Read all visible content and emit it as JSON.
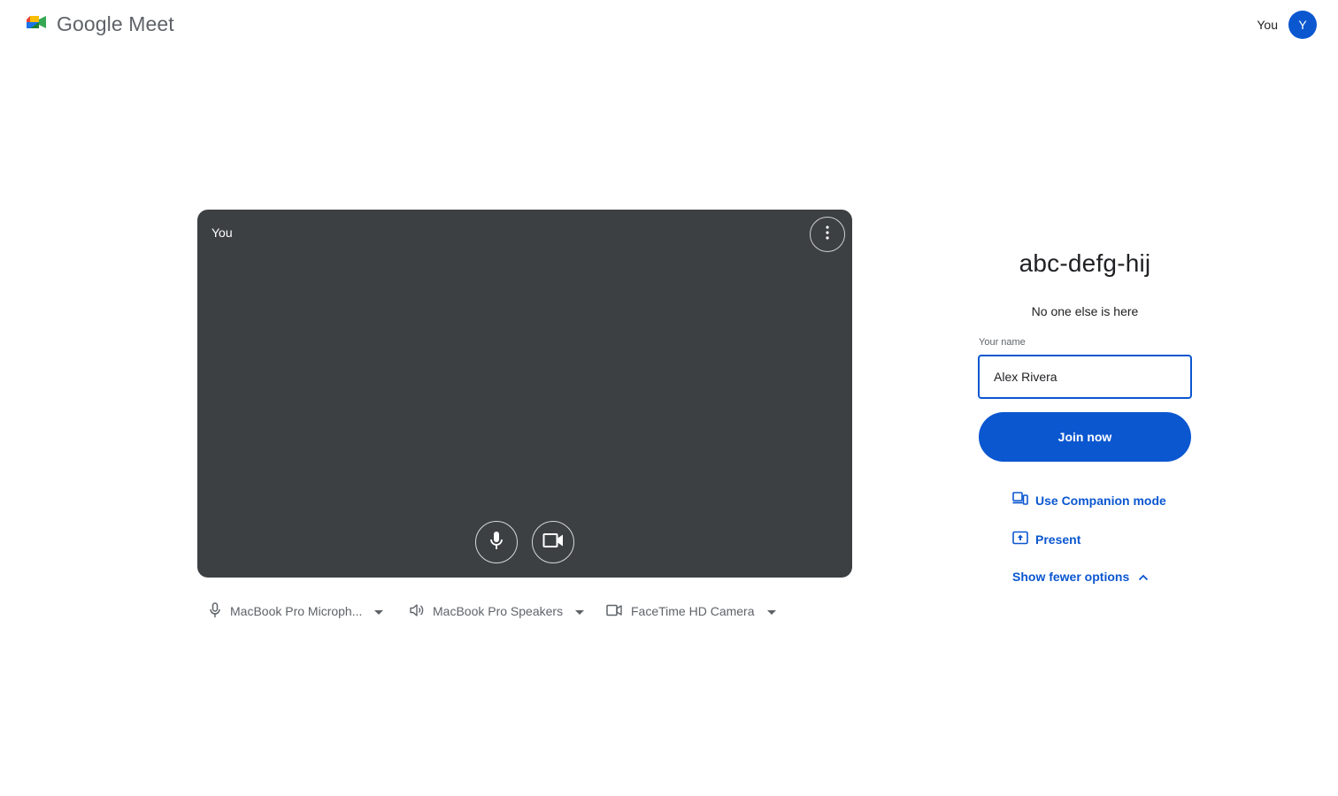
{
  "header": {
    "brand": "Google Meet",
    "account_name": "You",
    "avatar_initial": "Y"
  },
  "preview": {
    "self_label": "You",
    "more_icon": "more-vert-icon",
    "mic_icon": "microphone-icon",
    "camera_icon": "videocam-icon"
  },
  "devices": {
    "microphone": "MacBook Pro Microph...",
    "speaker": "MacBook Pro Speakers",
    "camera": "FaceTime HD Camera"
  },
  "meeting": {
    "code": "abc-defg-hij",
    "status": "No one else is here",
    "name_label": "Your name",
    "name_value": "Alex Rivera",
    "join_label": "Join now"
  },
  "options": {
    "companion": "Use Companion mode",
    "present": "Present",
    "fewer": "Show fewer options"
  },
  "colors": {
    "accent": "#0b57d0",
    "tile": "#3c4043",
    "muted_text": "#5f6368"
  }
}
